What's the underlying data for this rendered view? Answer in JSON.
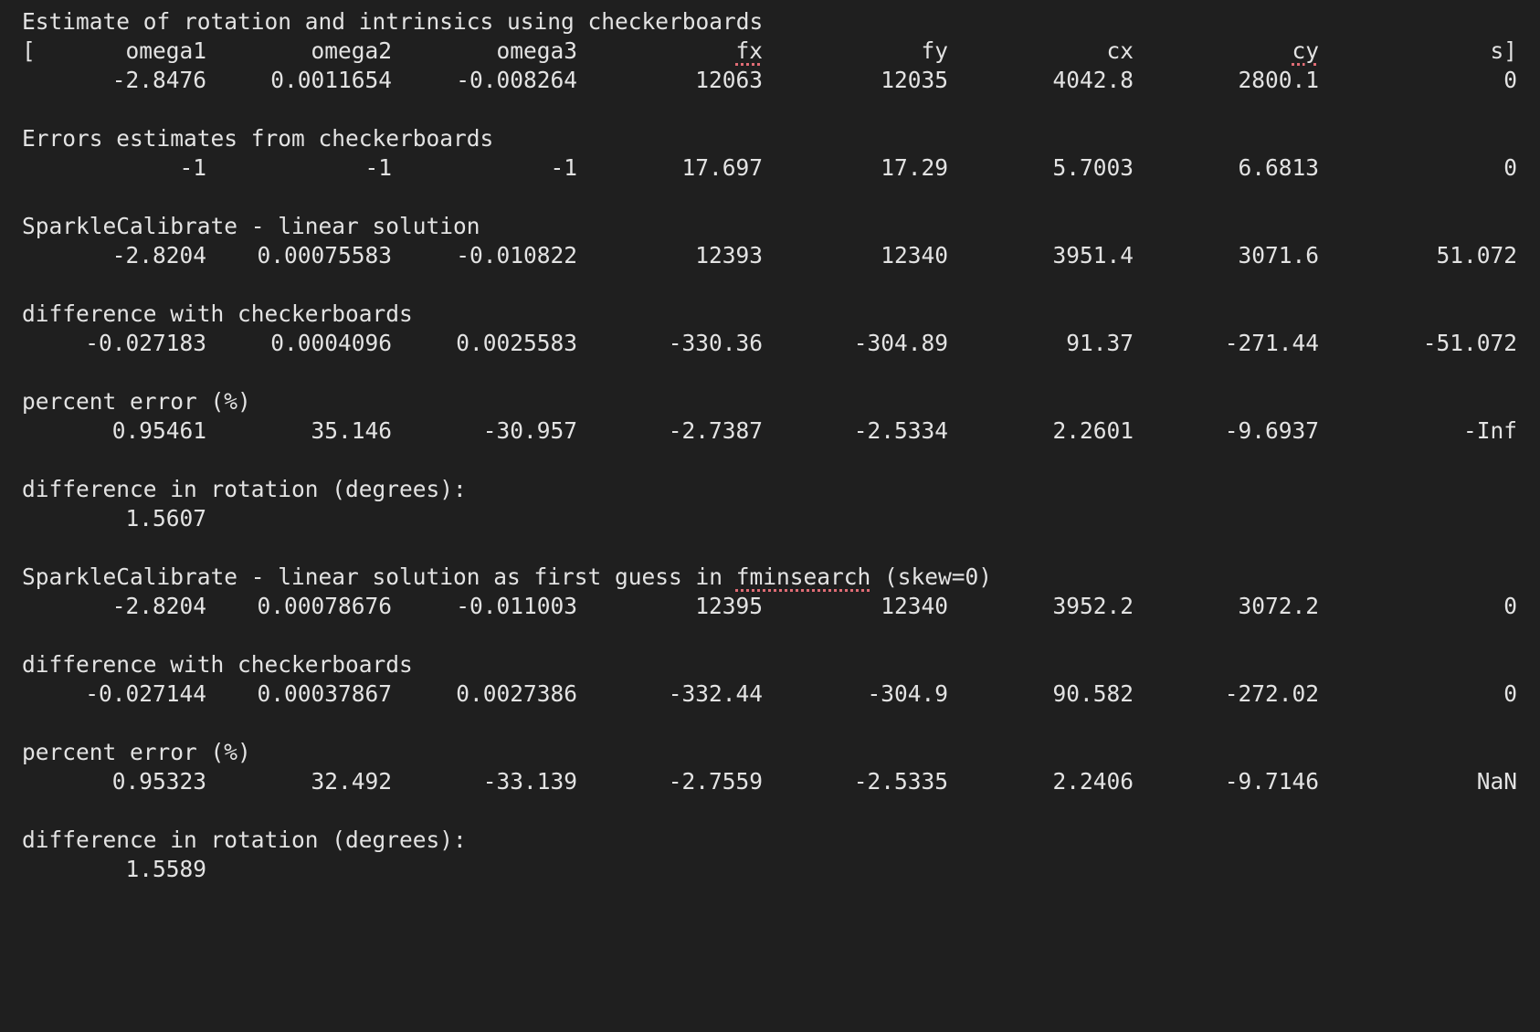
{
  "header_line": "Estimate of rotation and intrinsics using checkerboards",
  "columns": {
    "open_bracket": "[",
    "omega1": "omega1",
    "omega2": "omega2",
    "omega3": "omega3",
    "fx": "fx",
    "fy": "fy",
    "cx": "cx",
    "cy": "cy",
    "s": "s]"
  },
  "sections": [
    {
      "title": "",
      "values": [
        "-2.8476",
        "0.0011654",
        "-0.008264",
        "12063",
        "12035",
        "4042.8",
        "2800.1",
        "0"
      ]
    },
    {
      "title": "Errors estimates from checkerboards",
      "values": [
        "-1",
        "-1",
        "-1",
        "17.697",
        "17.29",
        "5.7003",
        "6.6813",
        "0"
      ]
    },
    {
      "title": "SparkleCalibrate - linear solution",
      "values": [
        "-2.8204",
        "0.00075583",
        "-0.010822",
        "12393",
        "12340",
        "3951.4",
        "3071.6",
        "51.072"
      ]
    },
    {
      "title": "difference with checkerboards",
      "values": [
        "-0.027183",
        "0.0004096",
        "0.0025583",
        "-330.36",
        "-304.89",
        "91.37",
        "-271.44",
        "-51.072"
      ]
    },
    {
      "title": "percent error (%)",
      "values": [
        "0.95461",
        "35.146",
        "-30.957",
        "-2.7387",
        "-2.5334",
        "2.2601",
        "-9.6937",
        "-Inf"
      ]
    },
    {
      "title": "difference in rotation (degrees):",
      "single": "1.5607"
    },
    {
      "title_parts": [
        "SparkleCalibrate - linear solution as first guess in ",
        "fminsearch",
        " (skew=0)"
      ],
      "values": [
        "-2.8204",
        "0.00078676",
        "-0.011003",
        "12395",
        "12340",
        "3952.2",
        "3072.2",
        "0"
      ]
    },
    {
      "title": "difference with checkerboards",
      "values": [
        "-0.027144",
        "0.00037867",
        "0.0027386",
        "-332.44",
        "-304.9",
        "90.582",
        "-272.02",
        "0"
      ]
    },
    {
      "title": "percent error (%)",
      "values": [
        "0.95323",
        "32.492",
        "-33.139",
        "-2.7559",
        "-2.5335",
        "2.2406",
        "-9.7146",
        "NaN"
      ]
    },
    {
      "title": "difference in rotation (degrees):",
      "single": "1.5589"
    }
  ],
  "colors": {
    "background": "#1f1f1f",
    "text": "#e3e3e3",
    "spellcheck_underline": "#e06c75"
  }
}
